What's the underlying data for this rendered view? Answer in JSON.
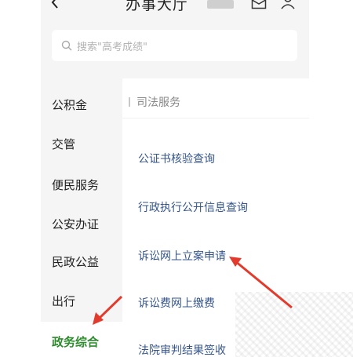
{
  "header": {
    "title": "办事大厅",
    "icons": [
      "back-icon",
      "message-icon",
      "user-icon"
    ]
  },
  "search": {
    "placeholder": "搜索\"高考成绩\""
  },
  "sidebar": {
    "items": [
      {
        "label": "公积金",
        "active": false
      },
      {
        "label": "交管",
        "active": false
      },
      {
        "label": "便民服务",
        "active": false
      },
      {
        "label": "公安办证",
        "active": false
      },
      {
        "label": "民政公益",
        "active": false
      },
      {
        "label": "出行",
        "active": false
      },
      {
        "label": "政务综合",
        "active": true
      }
    ]
  },
  "content": {
    "section_title": "司法服务",
    "links": [
      "公证书核验查询",
      "行政执行公开信息查询",
      "诉讼网上立案申请",
      "诉讼费网上缴费",
      "法院审判结果签收"
    ]
  },
  "colors": {
    "accent_green": "#2e8b2e",
    "link_blue": "#36568a",
    "annotation_red": "#e23b2e",
    "background": "#f5f5f5"
  }
}
